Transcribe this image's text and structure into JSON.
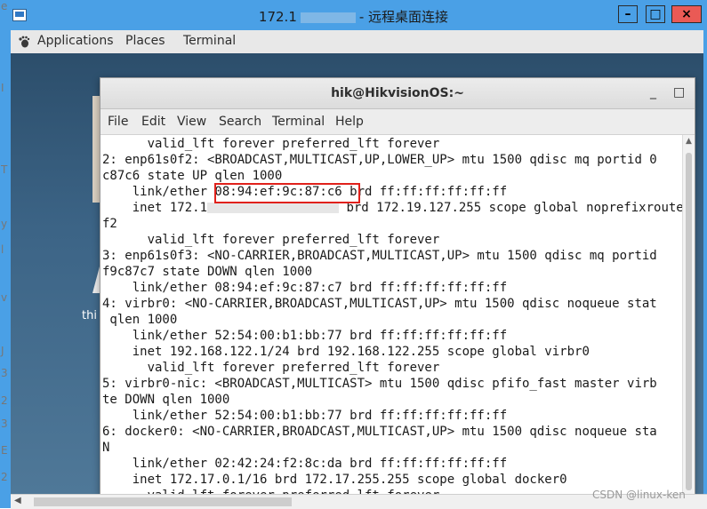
{
  "rdp": {
    "title_prefix": "172.1",
    "title_suffix": "- 远程桌面连接",
    "minimize": "–",
    "maximize": "□",
    "close": "×"
  },
  "panel": {
    "applications": "Applications",
    "places": "Places",
    "terminal": "Terminal"
  },
  "desktop": {
    "label": "thi"
  },
  "left_edge_chars": [
    "e",
    "I",
    "T",
    "y",
    "l",
    "v",
    "J",
    "3",
    "2",
    "3",
    "E",
    "2"
  ],
  "terminal": {
    "title": "hik@HikvisionOS:~",
    "menu": [
      "File",
      "Edit",
      "View",
      "Search",
      "Terminal",
      "Help"
    ],
    "lines": [
      "      valid_lft forever preferred_lft forever",
      "2: enp61s0f2: <BROADCAST,MULTICAST,UP,LOWER_UP> mtu 1500 qdisc mq portid 0",
      "c87c6 state UP qlen 1000",
      "    link/ether 08:94:ef:9c:87:c6 brd ff:ff:ff:ff:ff:ff",
      "    inet 172.1",
      "f2",
      "      valid_lft forever preferred_lft forever",
      "3: enp61s0f3: <NO-CARRIER,BROADCAST,MULTICAST,UP> mtu 1500 qdisc mq portid",
      "f9c87c7 state DOWN qlen 1000",
      "    link/ether 08:94:ef:9c:87:c7 brd ff:ff:ff:ff:ff:ff",
      "4: virbr0: <NO-CARRIER,BROADCAST,MULTICAST,UP> mtu 1500 qdisc noqueue stat",
      " qlen 1000",
      "    link/ether 52:54:00:b1:bb:77 brd ff:ff:ff:ff:ff:ff",
      "    inet 192.168.122.1/24 brd 192.168.122.255 scope global virbr0",
      "      valid_lft forever preferred_lft forever",
      "5: virbr0-nic: <BROADCAST,MULTICAST> mtu 1500 qdisc pfifo_fast master virb",
      "te DOWN qlen 1000",
      "    link/ether 52:54:00:b1:bb:77 brd ff:ff:ff:ff:ff:ff",
      "6: docker0: <NO-CARRIER,BROADCAST,MULTICAST,UP> mtu 1500 qdisc noqueue sta",
      "N",
      "    link/ether 02:42:24:f2:8c:da brd ff:ff:ff:ff:ff:ff",
      "    inet 172.17.0.1/16 brd 172.17.255.255 scope global docker0",
      "      valid_lft forever preferred_lft forever"
    ],
    "inet_line_tail": " brd 172.19.127.255 scope global noprefixroute e",
    "highlight_mac": "08:94:ef:9c:87:c6",
    "highlight_color": "#e0211b"
  },
  "watermark": "CSDN @linux-ken"
}
